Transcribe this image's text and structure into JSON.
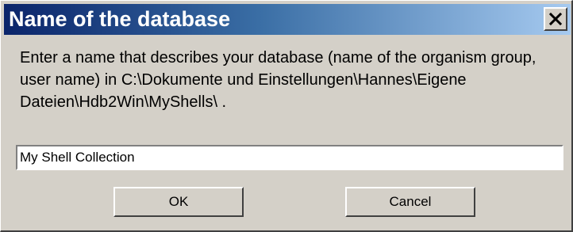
{
  "dialog": {
    "title": "Name of the database",
    "message": "Enter a name that describes your database (name of the organism group, user name) in C:\\Dokumente und Einstellungen\\Hannes\\Eigene Dateien\\Hdb2Win\\MyShells\\ .",
    "input_value": "My Shell Collection",
    "ok_label": "OK",
    "cancel_label": "Cancel"
  },
  "colors": {
    "titlebar_start": "#0a246a",
    "titlebar_end": "#a6caf0",
    "dialog_bg": "#d4d0c8"
  },
  "icons": {
    "close": "close-icon"
  }
}
